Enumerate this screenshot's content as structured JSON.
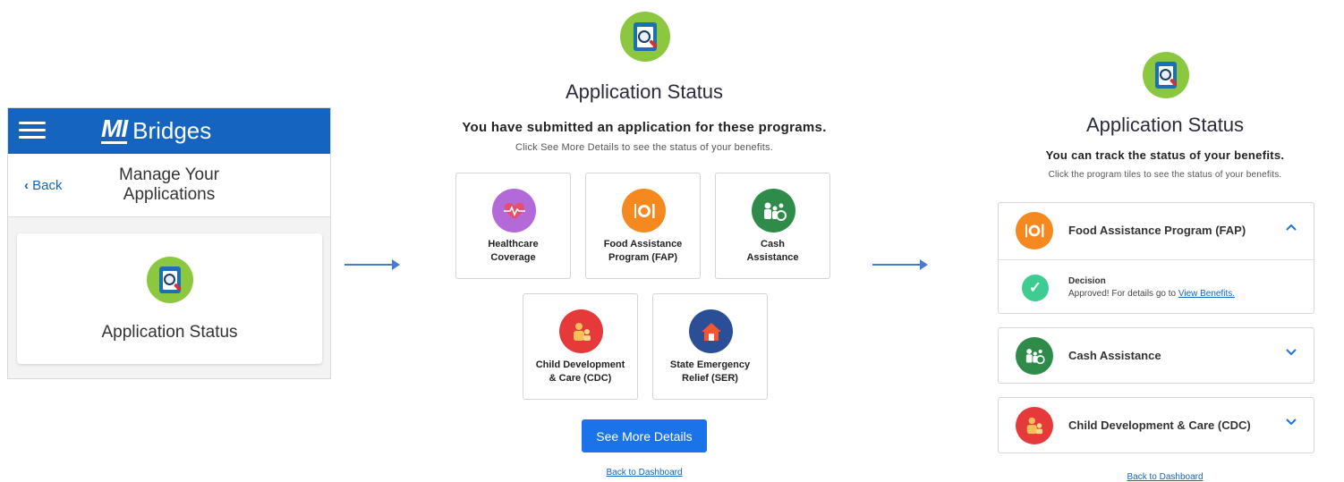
{
  "colors": {
    "header_blue": "#1565c0",
    "logo_green": "#8bc83f",
    "button_blue": "#1a73e8",
    "healthcare": "#b36ad8",
    "food": "#f5891f",
    "cash": "#2e8b4a",
    "child": "#e63a3a",
    "ser": "#2b4f97",
    "check": "#3dcc91"
  },
  "screen1": {
    "brand_mi": "MI",
    "brand_name": "Bridges",
    "back_label": "Back",
    "back_icon": "chevron-left-icon",
    "page_title": "Manage Your Applications",
    "card_label": "Application Status",
    "card_icon": "application-status-icon"
  },
  "screen2": {
    "title": "Application Status",
    "subtitle": "You have submitted an application for these programs.",
    "instructions": "Click See More Details to see the status of your benefits.",
    "tiles": [
      {
        "label": "Healthcare\nCoverage",
        "icon": "heart-pulse-icon",
        "color": "#b36ad8"
      },
      {
        "label": "Food Assistance\nProgram (FAP)",
        "icon": "plate-fork-knife-icon",
        "color": "#f5891f"
      },
      {
        "label": "Cash\nAssistance",
        "icon": "family-icon",
        "color": "#2e8b4a"
      },
      {
        "label": "Child Development\n& Care (CDC)",
        "icon": "parent-child-icon",
        "color": "#e63a3a"
      },
      {
        "label": "State Emergency\nRelief (SER)",
        "icon": "house-icon",
        "color": "#2b4f97"
      }
    ],
    "button_label": "See More Details",
    "back_link": "Back to Dashboard"
  },
  "screen3": {
    "title": "Application Status",
    "subtitle": "You can track the status of your benefits.",
    "instructions": "Click the program tiles to see the status of your benefits.",
    "programs": [
      {
        "label": "Food Assistance Program (FAP)",
        "icon": "plate-fork-knife-icon",
        "expanded": true,
        "chevron": "chevron-up-icon"
      },
      {
        "label": "Cash Assistance",
        "icon": "family-icon",
        "expanded": false,
        "chevron": "chevron-down-icon"
      },
      {
        "label": "Child Development & Care (CDC)",
        "icon": "parent-child-icon",
        "expanded": false,
        "chevron": "chevron-down-icon"
      }
    ],
    "decision_title": "Decision",
    "decision_text": "Approved! For details go to",
    "decision_link": "View Benefits.",
    "back_link": "Back to Dashboard"
  }
}
